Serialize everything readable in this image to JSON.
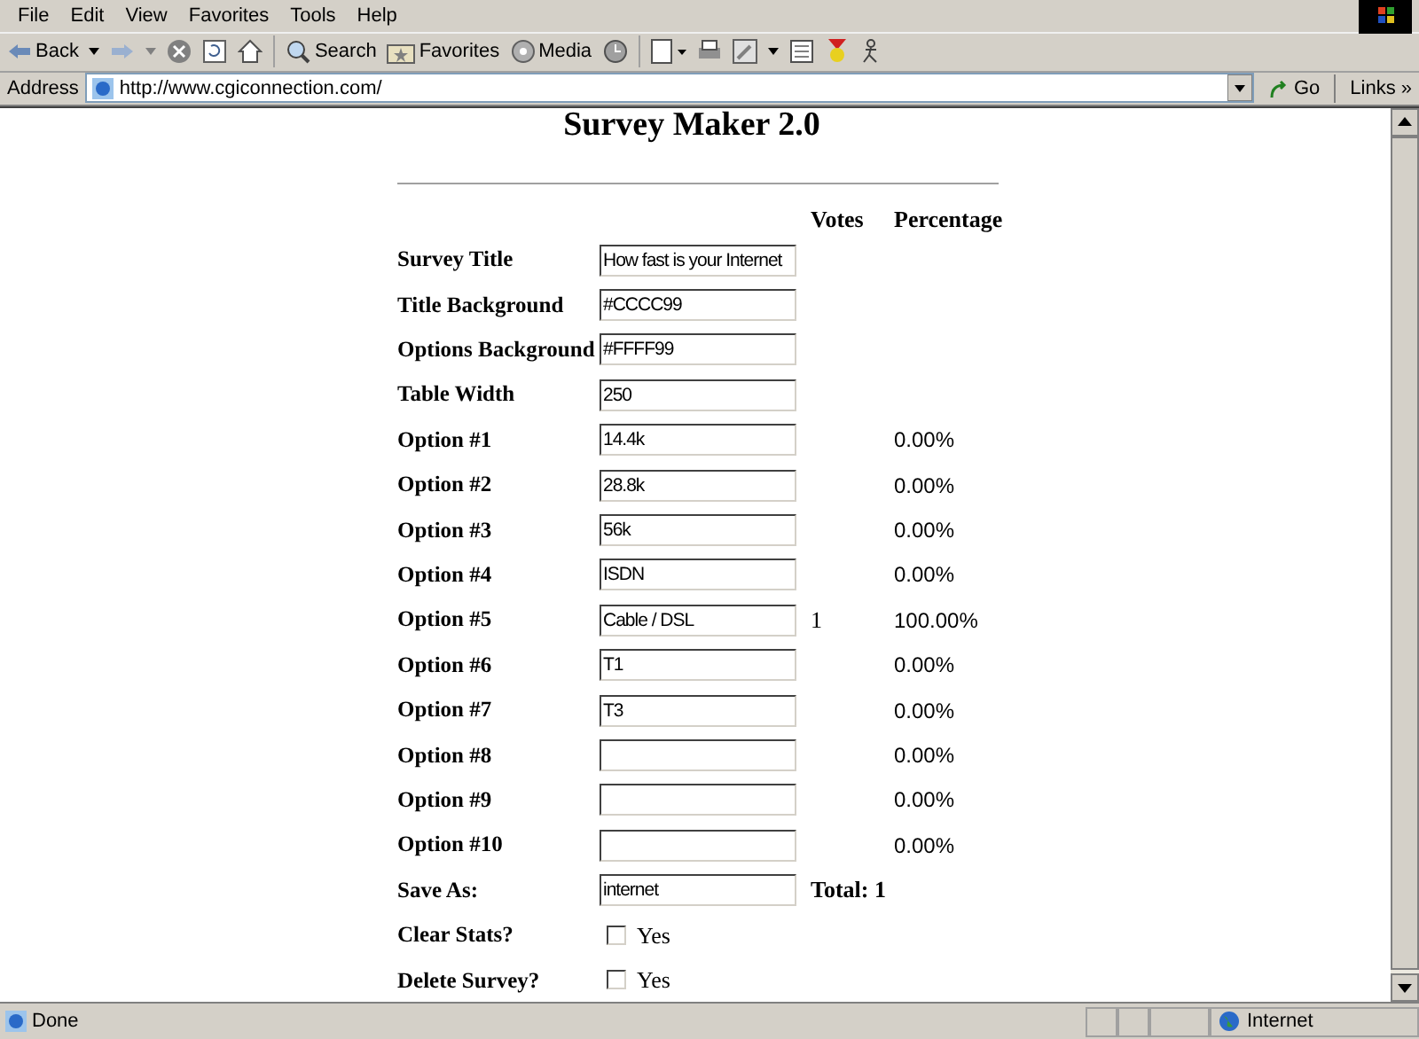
{
  "menu": [
    "File",
    "Edit",
    "View",
    "Favorites",
    "Tools",
    "Help"
  ],
  "toolbar": {
    "back": "Back",
    "search": "Search",
    "favorites": "Favorites",
    "media": "Media"
  },
  "address": {
    "label": "Address",
    "url": "http://www.cgiconnection.com/",
    "go": "Go",
    "links": "Links",
    "more": "»"
  },
  "page": {
    "title": "Survey Maker 2.0",
    "columns": [
      "Votes",
      "Percentage"
    ],
    "rows": [
      {
        "kind": "text",
        "label": "Survey Title",
        "value": "How fast is your Internet"
      },
      {
        "kind": "text",
        "label": "Title Background",
        "value": "#CCCC99"
      },
      {
        "kind": "text",
        "label": "Options Background",
        "value": "#FFFF99"
      },
      {
        "kind": "text",
        "label": "Table Width",
        "value": "250"
      },
      {
        "kind": "text",
        "label": "Option #1",
        "value": "14.4k",
        "percentage": "0.00%"
      },
      {
        "kind": "text",
        "label": "Option #2",
        "value": "28.8k",
        "percentage": "0.00%"
      },
      {
        "kind": "text",
        "label": "Option #3",
        "value": "56k",
        "percentage": "0.00%"
      },
      {
        "kind": "text",
        "label": "Option #4",
        "value": "ISDN",
        "percentage": "0.00%"
      },
      {
        "kind": "text",
        "label": "Option #5",
        "value": "Cable / DSL",
        "votes": "1",
        "percentage": "100.00%"
      },
      {
        "kind": "text",
        "label": "Option #6",
        "value": "T1",
        "percentage": "0.00%"
      },
      {
        "kind": "text",
        "label": "Option #7",
        "value": "T3",
        "percentage": "0.00%"
      },
      {
        "kind": "text",
        "label": "Option #8",
        "percentage": "0.00%"
      },
      {
        "kind": "text",
        "label": "Option #9",
        "percentage": "0.00%"
      },
      {
        "kind": "text",
        "label": "Option #10",
        "percentage": "0.00%"
      },
      {
        "kind": "text",
        "label": "Save As:",
        "value": "internet",
        "total": "Total: 1"
      },
      {
        "kind": "checkbox",
        "label": "Clear Stats?",
        "checked": false,
        "option": "Yes"
      },
      {
        "kind": "checkbox",
        "label": "Delete Survey?",
        "checked": false,
        "option": "Yes"
      }
    ]
  },
  "status": {
    "text": "Done",
    "zone": "Internet"
  }
}
